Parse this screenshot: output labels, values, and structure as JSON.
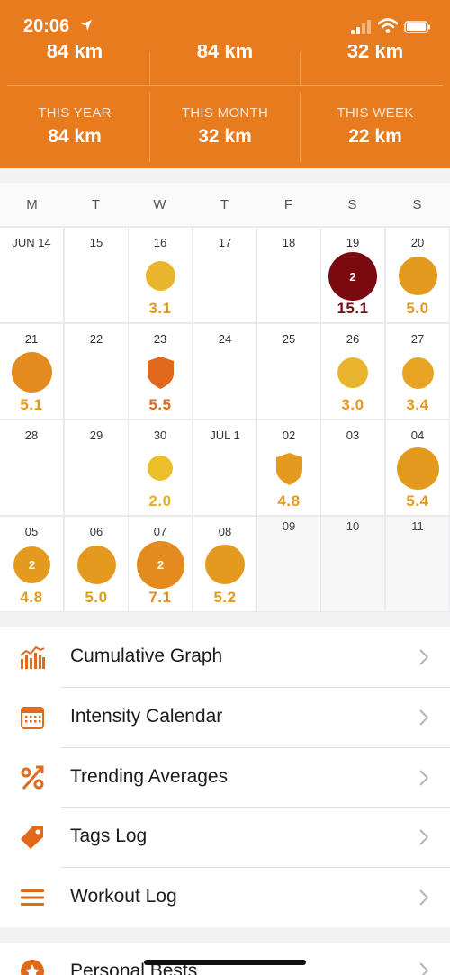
{
  "status_bar": {
    "time": "20:06"
  },
  "top_partial": [
    "84 km",
    "84 km",
    "32 km"
  ],
  "stats": [
    {
      "label": "THIS YEAR",
      "value": "84 km"
    },
    {
      "label": "THIS MONTH",
      "value": "32 km"
    },
    {
      "label": "THIS WEEK",
      "value": "22 km"
    }
  ],
  "calendar": {
    "weekdays": [
      "M",
      "T",
      "W",
      "T",
      "F",
      "S",
      "S"
    ],
    "weeks": [
      [
        {
          "day": "JUN 14"
        },
        {
          "day": "15"
        },
        {
          "day": "16",
          "dist": "3.1"
        },
        {
          "day": "17"
        },
        {
          "day": "18"
        },
        {
          "day": "19",
          "dist": "15.1",
          "count": "2"
        },
        {
          "day": "20",
          "dist": "5.0"
        }
      ],
      [
        {
          "day": "21",
          "dist": "5.1"
        },
        {
          "day": "22"
        },
        {
          "day": "23",
          "dist": "5.5"
        },
        {
          "day": "24"
        },
        {
          "day": "25"
        },
        {
          "day": "26",
          "dist": "3.0"
        },
        {
          "day": "27",
          "dist": "3.4"
        }
      ],
      [
        {
          "day": "28"
        },
        {
          "day": "29"
        },
        {
          "day": "30",
          "dist": "2.0"
        },
        {
          "day": "JUL 1"
        },
        {
          "day": "02",
          "dist": "4.8"
        },
        {
          "day": "03"
        },
        {
          "day": "04",
          "dist": "5.4"
        }
      ],
      [
        {
          "day": "05",
          "dist": "4.8",
          "count": "2"
        },
        {
          "day": "06",
          "dist": "5.0"
        },
        {
          "day": "07",
          "dist": "7.1",
          "count": "2"
        },
        {
          "day": "08",
          "dist": "5.2"
        },
        {
          "day": "09"
        },
        {
          "day": "10"
        },
        {
          "day": "11"
        }
      ]
    ]
  },
  "menu": [
    {
      "label": "Cumulative Graph",
      "icon": "bar-chart-icon"
    },
    {
      "label": "Intensity Calendar",
      "icon": "calendar-icon"
    },
    {
      "label": "Trending Averages",
      "icon": "percent-icon"
    },
    {
      "label": "Tags Log",
      "icon": "tag-icon"
    },
    {
      "label": "Workout Log",
      "icon": "list-icon"
    }
  ],
  "menu2": [
    {
      "label": "Personal Bests",
      "icon": "star-icon"
    }
  ],
  "colors": {
    "header": "#e87b1e",
    "dot_light": "#e9b52c",
    "dot_mid": "#e39a1f",
    "dot_dark": "#7a0a10",
    "shield": "#e0691c"
  }
}
